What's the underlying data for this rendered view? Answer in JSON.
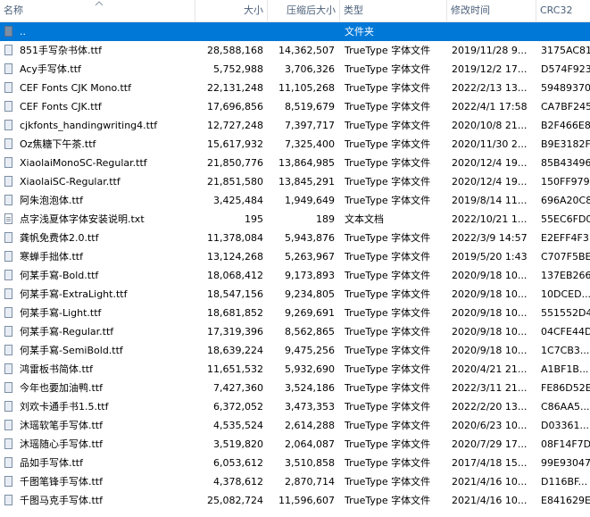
{
  "columns": {
    "name": "名称",
    "size": "大小",
    "compressed": "压缩后大小",
    "type": "类型",
    "modified": "修改时间",
    "crc": "CRC32"
  },
  "parent_row": {
    "name": "..",
    "type": "文件夹"
  },
  "files": [
    {
      "name": "851手写杂书体.ttf",
      "size": "28,588,168",
      "compressed": "14,362,507",
      "type": "TrueType 字体文件",
      "modified": "2019/11/28 9...",
      "crc": "3175AC81",
      "icon": "font-file-icon"
    },
    {
      "name": "Acy手写体.ttf",
      "size": "5,752,988",
      "compressed": "3,706,326",
      "type": "TrueType 字体文件",
      "modified": "2019/12/2 17...",
      "crc": "D574F923",
      "icon": "font-file-icon"
    },
    {
      "name": "CEF Fonts CJK Mono.ttf",
      "size": "22,131,248",
      "compressed": "11,105,268",
      "type": "TrueType 字体文件",
      "modified": "2022/2/13 13...",
      "crc": "59489370",
      "icon": "font-file-icon"
    },
    {
      "name": "CEF Fonts CJK.ttf",
      "size": "17,696,856",
      "compressed": "8,519,679",
      "type": "TrueType 字体文件",
      "modified": "2022/4/1 17:58",
      "crc": "CA7BF245",
      "icon": "font-file-icon"
    },
    {
      "name": "cjkfonts_handingwriting4.ttf",
      "size": "12,727,248",
      "compressed": "7,397,717",
      "type": "TrueType 字体文件",
      "modified": "2020/10/8 21...",
      "crc": "B2F466E8",
      "icon": "font-file-icon"
    },
    {
      "name": "Oz焦糖下午茶.ttf",
      "size": "15,617,932",
      "compressed": "7,325,400",
      "type": "TrueType 字体文件",
      "modified": "2020/11/30 2...",
      "crc": "B9E3182F",
      "icon": "font-file-icon"
    },
    {
      "name": "XiaolaiMonoSC-Regular.ttf",
      "size": "21,850,776",
      "compressed": "13,864,985",
      "type": "TrueType 字体文件",
      "modified": "2020/12/4 19...",
      "crc": "85B43496",
      "icon": "font-file-icon"
    },
    {
      "name": "XiaolaiSC-Regular.ttf",
      "size": "21,851,580",
      "compressed": "13,845,291",
      "type": "TrueType 字体文件",
      "modified": "2020/12/4 19...",
      "crc": "150FF979",
      "icon": "font-file-icon"
    },
    {
      "name": "阿朱泡泡体.ttf",
      "size": "3,425,484",
      "compressed": "1,949,649",
      "type": "TrueType 字体文件",
      "modified": "2019/8/14 11...",
      "crc": "696A20C8",
      "icon": "font-file-icon"
    },
    {
      "name": "点字浅夏体字体安装说明.txt",
      "size": "195",
      "compressed": "189",
      "type": "文本文档",
      "modified": "2022/10/21 1...",
      "crc": "55EC6FD0",
      "icon": "text-file-icon"
    },
    {
      "name": "龚帆免费体2.0.ttf",
      "size": "11,378,084",
      "compressed": "5,943,876",
      "type": "TrueType 字体文件",
      "modified": "2022/3/9 14:57",
      "crc": "E2EFF4F3",
      "icon": "font-file-icon"
    },
    {
      "name": "寒蝉手拙体.ttf",
      "size": "13,124,268",
      "compressed": "5,263,967",
      "type": "TrueType 字体文件",
      "modified": "2019/5/20 1:43",
      "crc": "C707F5BE",
      "icon": "font-file-icon"
    },
    {
      "name": "何某手寫-Bold.ttf",
      "size": "18,068,412",
      "compressed": "9,173,893",
      "type": "TrueType 字体文件",
      "modified": "2020/9/18 10...",
      "crc": "137EB266",
      "icon": "font-file-icon"
    },
    {
      "name": "何某手寫-ExtraLight.ttf",
      "size": "18,547,156",
      "compressed": "9,234,805",
      "type": "TrueType 字体文件",
      "modified": "2020/9/18 10...",
      "crc": "10DCED...",
      "icon": "font-file-icon"
    },
    {
      "name": "何某手寫-Light.ttf",
      "size": "18,681,852",
      "compressed": "9,269,691",
      "type": "TrueType 字体文件",
      "modified": "2020/9/18 10...",
      "crc": "551552D4",
      "icon": "font-file-icon"
    },
    {
      "name": "何某手寫-Regular.ttf",
      "size": "17,319,396",
      "compressed": "8,562,865",
      "type": "TrueType 字体文件",
      "modified": "2020/9/18 10...",
      "crc": "04CFE44D",
      "icon": "font-file-icon"
    },
    {
      "name": "何某手寫-SemiBold.ttf",
      "size": "18,639,224",
      "compressed": "9,475,256",
      "type": "TrueType 字体文件",
      "modified": "2020/9/18 10...",
      "crc": "1C7CB3...",
      "icon": "font-file-icon"
    },
    {
      "name": "鸿雷板书简体.ttf",
      "size": "11,651,532",
      "compressed": "5,932,690",
      "type": "TrueType 字体文件",
      "modified": "2020/4/21 21...",
      "crc": "A1BF1B...",
      "icon": "font-file-icon"
    },
    {
      "name": "今年也要加油鸭.ttf",
      "size": "7,427,360",
      "compressed": "3,524,186",
      "type": "TrueType 字体文件",
      "modified": "2022/3/11 21...",
      "crc": "FE86D52E",
      "icon": "font-file-icon"
    },
    {
      "name": "刘欢卡通手书1.5.ttf",
      "size": "6,372,052",
      "compressed": "3,473,353",
      "type": "TrueType 字体文件",
      "modified": "2022/2/20 13...",
      "crc": "C86AA5...",
      "icon": "font-file-icon"
    },
    {
      "name": "沐瑶软笔手写体.ttf",
      "size": "4,535,524",
      "compressed": "2,614,288",
      "type": "TrueType 字体文件",
      "modified": "2020/6/23 10...",
      "crc": "D03361...",
      "icon": "font-file-icon"
    },
    {
      "name": "沐瑶随心手写体.ttf",
      "size": "3,519,820",
      "compressed": "2,064,087",
      "type": "TrueType 字体文件",
      "modified": "2020/7/29 17...",
      "crc": "08F14F7D",
      "icon": "font-file-icon"
    },
    {
      "name": "品如手写体.ttf",
      "size": "6,053,612",
      "compressed": "3,510,858",
      "type": "TrueType 字体文件",
      "modified": "2017/4/18 15...",
      "crc": "99E93047",
      "icon": "font-file-icon"
    },
    {
      "name": "千图笔锋手写体.ttf",
      "size": "4,378,612",
      "compressed": "2,870,714",
      "type": "TrueType 字体文件",
      "modified": "2021/4/16 10...",
      "crc": "D116BF...",
      "icon": "font-file-icon"
    },
    {
      "name": "千图马克手写体.ttf",
      "size": "25,082,724",
      "compressed": "11,596,607",
      "type": "TrueType 字体文件",
      "modified": "2021/4/16 10...",
      "crc": "E841629E",
      "icon": "font-file-icon"
    }
  ],
  "colors": {
    "selection": "#0078d7",
    "header_text": "#4c607a"
  }
}
